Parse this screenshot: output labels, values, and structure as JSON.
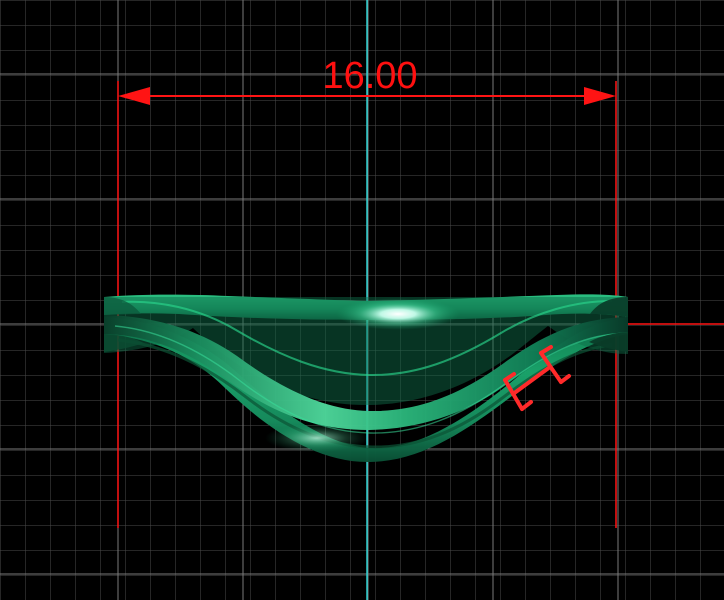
{
  "viewport": {
    "background_color": "#000000",
    "grid_color": "#5a5a5a",
    "axis_color": "#2fd3d3"
  },
  "dimension": {
    "label": "16.00",
    "color": "#ff1414"
  },
  "ring_model": {
    "color": "#18a26a",
    "highlight_color": "#bffbe6",
    "shadow_color": "#06472c"
  },
  "thickness_marker": {
    "color": "#ff2a2a"
  }
}
